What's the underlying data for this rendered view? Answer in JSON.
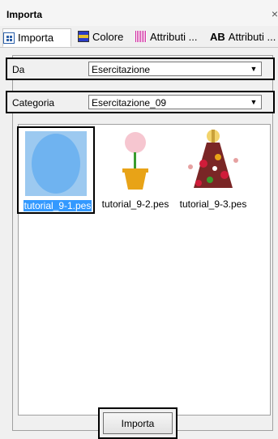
{
  "panel": {
    "title": "Importa",
    "close_symbol": "×"
  },
  "tabs": [
    {
      "label": "Importa",
      "icon": "import-icon",
      "active": true
    },
    {
      "label": "Colore",
      "icon": "color-icon",
      "active": false
    },
    {
      "label": "Attributi ...",
      "icon": "stitch-attributes-icon",
      "active": false
    },
    {
      "label": "Attributi ...",
      "icon": "text-attributes-icon",
      "icon_text": "AB",
      "active": false
    }
  ],
  "source": {
    "label": "Da",
    "value": "Esercitazione"
  },
  "category": {
    "label": "Categoria",
    "value": "Esercitazione_09"
  },
  "files": [
    {
      "name": "tutorial_9-1.pes",
      "selected": true,
      "preview": "blue-oval"
    },
    {
      "name": "tutorial_9-2.pes",
      "selected": false,
      "preview": "flower-pot"
    },
    {
      "name": "tutorial_9-3.pes",
      "selected": false,
      "preview": "floral-dress-figure"
    }
  ],
  "import_button": {
    "label": "Importa"
  },
  "colors": {
    "selection": "#3399ff",
    "oval": "#6fb3f0",
    "pot": "#e8a317",
    "flower": "#f6c6d0",
    "stem": "#3a9c2e"
  }
}
